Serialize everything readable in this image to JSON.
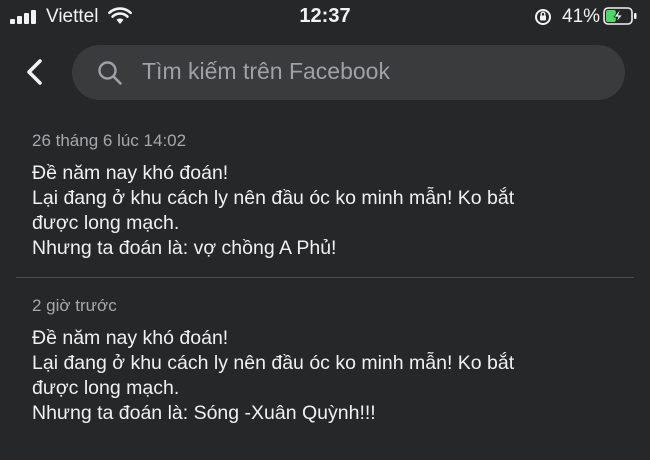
{
  "status_bar": {
    "carrier": "Viettel",
    "time": "12:37",
    "battery_percent": "41%",
    "battery_level": 0.41,
    "signal_bars": 4
  },
  "header": {
    "search_placeholder": "Tìm kiếm trên Facebook",
    "back_icon": "chevron-left-icon",
    "search_icon": "magnifier-icon"
  },
  "posts": [
    {
      "time": "26 tháng 6 lúc 14:02",
      "lines": [
        "Đề năm nay khó đoán!",
        "Lại đang ở khu cách ly nên đầu óc ko minh mẫn! Ko bắt",
        "được long mạch.",
        "Nhưng ta đoán là: vợ chồng A Phủ!"
      ]
    },
    {
      "time": "2 giờ trước",
      "lines": [
        "Đề năm nay khó đoán!",
        "Lại đang ở khu cách ly nên đầu óc ko minh mẫn! Ko bắt",
        "được long mạch.",
        "Nhưng ta đoán là: Sóng -Xuân Quỳnh!!!"
      ]
    }
  ],
  "colors": {
    "background": "#262728",
    "search_field": "#3a3b3c",
    "battery_fill": "#4cd964"
  }
}
